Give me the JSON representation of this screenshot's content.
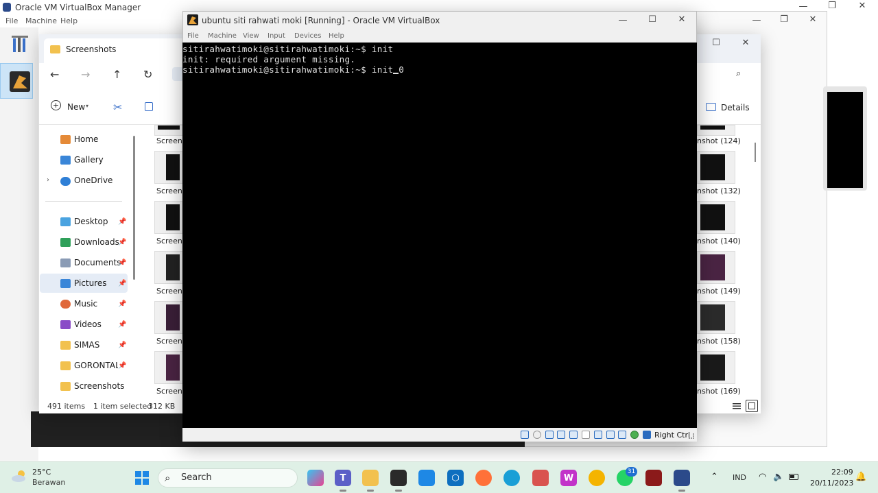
{
  "manager": {
    "title": "Oracle VM VirtualBox Manager",
    "menu": [
      "File",
      "Machine",
      "Help"
    ]
  },
  "explorer": {
    "tab_title": "Screenshots",
    "new_label": "New",
    "details_label": "Details",
    "sidebar": [
      {
        "label": "Home",
        "icon": "home-icon",
        "pinned": false
      },
      {
        "label": "Gallery",
        "icon": "gallery-icon",
        "pinned": false
      },
      {
        "label": "OneDrive",
        "icon": "cloud-icon",
        "pinned": false
      },
      {
        "label": "Desktop",
        "icon": "desktop-icon",
        "pinned": true
      },
      {
        "label": "Downloads",
        "icon": "download-icon",
        "pinned": true
      },
      {
        "label": "Documents",
        "icon": "document-icon",
        "pinned": true
      },
      {
        "label": "Pictures",
        "icon": "pictures-icon",
        "pinned": true
      },
      {
        "label": "Music",
        "icon": "music-icon",
        "pinned": true
      },
      {
        "label": "Videos",
        "icon": "video-icon",
        "pinned": true
      },
      {
        "label": "SIMAS",
        "icon": "folder-icon",
        "pinned": true
      },
      {
        "label": "GORONTALC",
        "icon": "folder-icon",
        "pinned": true
      },
      {
        "label": "Screenshots",
        "icon": "folder-icon",
        "pinned": false
      }
    ],
    "left_thumb_labels": [
      "Screens",
      "Screens",
      "Screens",
      "Screens",
      "Screens",
      "Screens"
    ],
    "right_thumb_labels": [
      "nshot (124)",
      "nshot (132)",
      "nshot (140)",
      "nshot (149)",
      "nshot (158)",
      "nshot (169)"
    ],
    "status": {
      "items": "491 items",
      "selected": "1 item selected",
      "size": "312 KB"
    }
  },
  "vm": {
    "title": "ubuntu siti rahwati moki [Running] - Oracle VM VirtualBox",
    "menu": [
      "File",
      "Machine",
      "View",
      "Input",
      "Devices",
      "Help"
    ],
    "terminal": [
      "sitirahwatimoki@sitirahwatimoki:~$ init",
      "init: required argument missing.",
      "sitirahwatimoki@sitirahwatimoki:~$ init 0"
    ],
    "host_key": "Right Ctrl"
  },
  "taskbar": {
    "weather_temp": "25°C",
    "weather_desc": "Berawan",
    "search_placeholder": "Search",
    "whatsapp_badge": "31",
    "language": "IND",
    "time": "22:09",
    "date": "20/11/2023"
  },
  "colors": {
    "taskbar_bg": "#dff0e6",
    "terminal_bg": "#000000",
    "terminal_fg": "#e0e0e0",
    "selection": "#e5ecf6"
  }
}
